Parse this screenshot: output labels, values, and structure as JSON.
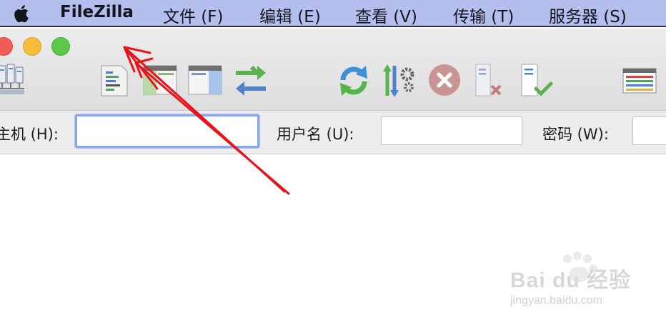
{
  "menubar": {
    "app_name": "FileZilla",
    "items": [
      {
        "label": "文件 (F)"
      },
      {
        "label": "编辑 (E)"
      },
      {
        "label": "查看 (V)"
      },
      {
        "label": "传输 (T)"
      },
      {
        "label": "服务器 (S)"
      }
    ]
  },
  "window": {
    "traffic_lights": {
      "close": "close-window",
      "minimize": "minimize-window",
      "maximize": "maximize-window"
    }
  },
  "toolbar": {
    "icons": [
      "site-manager-icon",
      "message-log-icon",
      "local-tree-icon",
      "remote-tree-icon",
      "transfer-queue-icon",
      "refresh-icon",
      "filter-settings-icon",
      "cancel-operation-icon",
      "disconnect-icon",
      "reconnect-icon",
      "directory-listing-icon"
    ]
  },
  "quickconnect": {
    "host_label": "主机 (H):",
    "host_value": "",
    "username_label": "用户名 (U):",
    "username_value": "",
    "password_label": "密码 (W):",
    "password_value": ""
  },
  "watermark": {
    "brand": "Bai du 经验",
    "url": "jingyan.baidu.com"
  },
  "colors": {
    "menubar_bg": "#b4bfee",
    "focus_ring": "#88a5e8",
    "annotation_arrow": "#e8141c"
  }
}
